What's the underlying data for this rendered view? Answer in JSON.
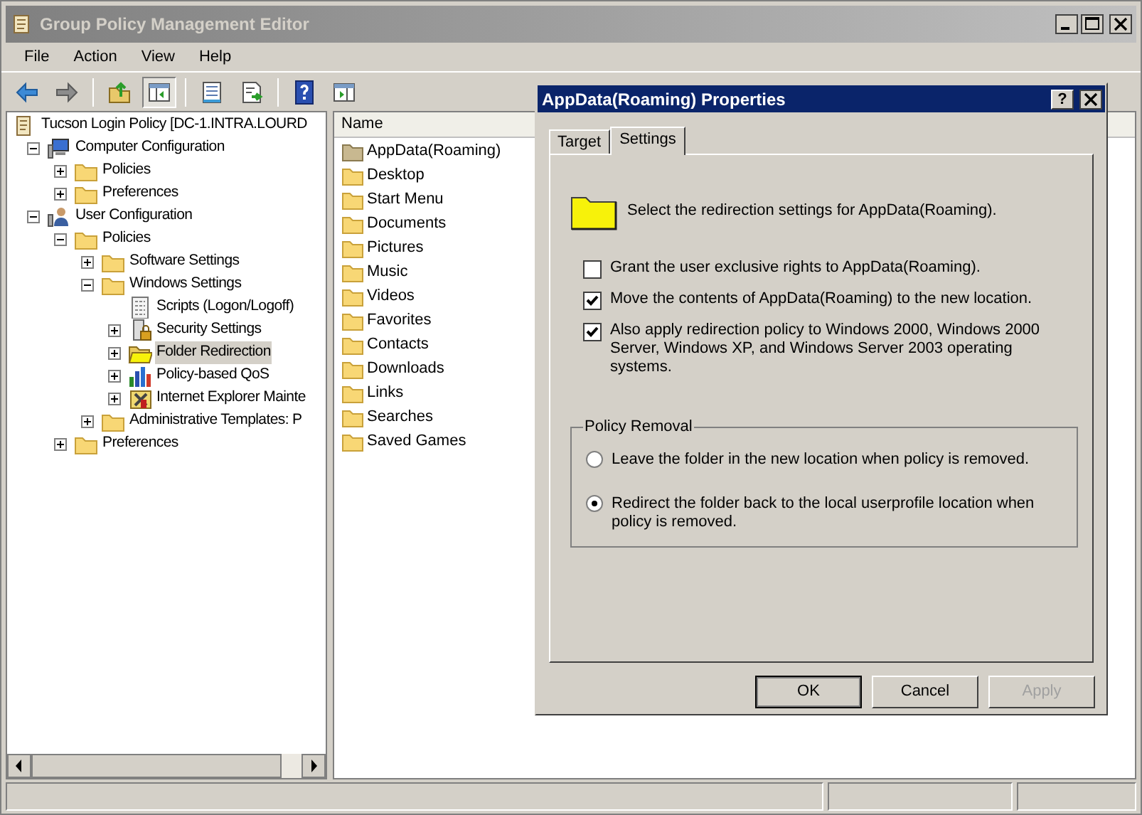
{
  "window": {
    "title": "Group Policy Management Editor"
  },
  "menu": [
    "File",
    "Action",
    "View",
    "Help"
  ],
  "toolbar": [
    {
      "kind": "back",
      "pressed": false
    },
    {
      "kind": "forward",
      "pressed": false
    },
    {
      "kind": "up",
      "pressed": false
    },
    {
      "kind": "tree",
      "pressed": true
    },
    {
      "kind": "properties",
      "pressed": false
    },
    {
      "kind": "export",
      "pressed": false
    },
    {
      "kind": "help",
      "pressed": false
    },
    {
      "kind": "actionpane",
      "pressed": false
    }
  ],
  "tree": [
    {
      "label": "Tucson Login Policy [DC-1.INTRA.LOURD",
      "kind": "policy",
      "selected": false,
      "children": [
        {
          "label": "Computer Configuration",
          "kind": "computer",
          "expanded": true,
          "selected": false,
          "children": [
            {
              "label": "Policies",
              "kind": "folder",
              "expanded": false,
              "selected": false
            },
            {
              "label": "Preferences",
              "kind": "folder",
              "expanded": false,
              "selected": false
            }
          ]
        },
        {
          "label": "User Configuration",
          "kind": "user",
          "expanded": true,
          "selected": false,
          "children": [
            {
              "label": "Policies",
              "kind": "folder",
              "expanded": true,
              "selected": false,
              "children": [
                {
                  "label": "Software Settings",
                  "kind": "folder",
                  "expanded": false,
                  "selected": false
                },
                {
                  "label": "Windows Settings",
                  "kind": "folder",
                  "expanded": true,
                  "selected": false,
                  "children": [
                    {
                      "label": "Scripts (Logon/Logoff)",
                      "kind": "scripts",
                      "selected": false
                    },
                    {
                      "label": "Security Settings",
                      "kind": "security",
                      "expanded": false,
                      "selected": false
                    },
                    {
                      "label": "Folder Redirection",
                      "kind": "openfolder",
                      "expanded": false,
                      "selected": true
                    },
                    {
                      "label": "Policy-based QoS",
                      "kind": "chart",
                      "expanded": false,
                      "selected": false
                    },
                    {
                      "label": "Internet Explorer Mainte",
                      "kind": "tools",
                      "expanded": false,
                      "selected": false
                    }
                  ]
                },
                {
                  "label": "Administrative Templates: P",
                  "kind": "folder",
                  "expanded": false,
                  "selected": false
                }
              ]
            },
            {
              "label": "Preferences",
              "kind": "folder",
              "expanded": false,
              "selected": false
            }
          ]
        }
      ]
    }
  ],
  "list": {
    "column": "Name",
    "items": [
      {
        "label": "AppData(Roaming)",
        "redirected": true
      },
      {
        "label": "Desktop",
        "redirected": false
      },
      {
        "label": "Start Menu",
        "redirected": false
      },
      {
        "label": "Documents",
        "redirected": false
      },
      {
        "label": "Pictures",
        "redirected": false
      },
      {
        "label": "Music",
        "redirected": false
      },
      {
        "label": "Videos",
        "redirected": false
      },
      {
        "label": "Favorites",
        "redirected": false
      },
      {
        "label": "Contacts",
        "redirected": false
      },
      {
        "label": "Downloads",
        "redirected": false
      },
      {
        "label": "Links",
        "redirected": false
      },
      {
        "label": "Searches",
        "redirected": false
      },
      {
        "label": "Saved Games",
        "redirected": false
      }
    ]
  },
  "dialog": {
    "title": "AppData(Roaming) Properties",
    "help_button": "?",
    "tabs": [
      {
        "label": "Target",
        "selected": false
      },
      {
        "label": "Settings",
        "selected": true
      }
    ],
    "intro": "Select the redirection settings for AppData(Roaming).",
    "options": [
      {
        "label": "Grant the user exclusive rights to AppData(Roaming).",
        "checked": false
      },
      {
        "label": "Move the contents of AppData(Roaming) to the new location.",
        "checked": true
      },
      {
        "label": "Also apply redirection policy to Windows 2000, Windows 2000 Server, Windows XP, and Windows Server 2003 operating systems.",
        "checked": true
      }
    ],
    "policy_removal": {
      "title": "Policy Removal",
      "choices": [
        {
          "label": "Leave the folder in the new location when policy is removed.",
          "selected": false
        },
        {
          "label": "Redirect the folder back to the local userprofile location when policy is removed.",
          "selected": true
        }
      ]
    },
    "buttons": [
      {
        "label": "OK",
        "default": true,
        "disabled": false
      },
      {
        "label": "Cancel",
        "default": false,
        "disabled": false
      },
      {
        "label": "Apply",
        "default": false,
        "disabled": true
      }
    ]
  }
}
